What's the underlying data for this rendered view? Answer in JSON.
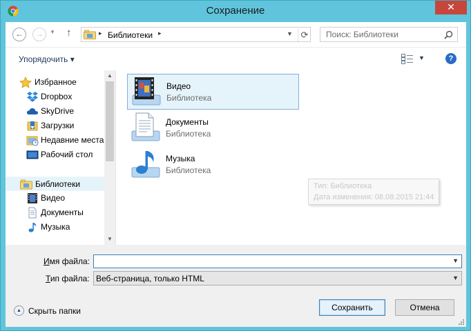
{
  "window": {
    "title": "Сохранение",
    "close_symbol": "✕",
    "app_icon": "chrome-icon"
  },
  "navigation": {
    "back_symbol": "←",
    "forward_symbol": "→",
    "recent_dropdown_symbol": "▼",
    "up_symbol": "↑",
    "address": {
      "location": "Библиотеки",
      "separator": "▸",
      "dropdown_symbol": "▼",
      "refresh_symbol": "⟳"
    },
    "search": {
      "placeholder": "Поиск: Библиотеки"
    }
  },
  "toolbar": {
    "organize_label": "Упорядочить ▾",
    "view_dropdown_symbol": "▼",
    "help_symbol": "?"
  },
  "nav_pane": {
    "favorites": {
      "label": "Избранное",
      "items": [
        {
          "label": "Dropbox",
          "icon": "dropbox-icon"
        },
        {
          "label": "SkyDrive",
          "icon": "cloud-icon"
        },
        {
          "label": "Загрузки",
          "icon": "downloads-folder-icon"
        },
        {
          "label": "Недавние места",
          "icon": "recent-places-icon"
        },
        {
          "label": "Рабочий стол",
          "icon": "desktop-icon"
        }
      ]
    },
    "libraries": {
      "label": "Библиотеки",
      "items": [
        {
          "label": "Видео",
          "icon": "video-library-icon"
        },
        {
          "label": "Документы",
          "icon": "documents-library-icon"
        },
        {
          "label": "Музыка",
          "icon": "music-library-icon"
        }
      ]
    },
    "scroll_up_symbol": "▲",
    "scroll_down_symbol": "▼"
  },
  "content": {
    "items": [
      {
        "name": "Видео",
        "type": "Библиотека",
        "icon": "video-library-icon",
        "selected": true
      },
      {
        "name": "Документы",
        "type": "Библиотека",
        "icon": "documents-library-icon",
        "selected": false
      },
      {
        "name": "Музыка",
        "type": "Библиотека",
        "icon": "music-library-icon",
        "selected": false
      }
    ],
    "tooltip": {
      "line1": "Тип: Библиотека",
      "line2": "Дата изменения: 08.08.2015 21:44"
    }
  },
  "form": {
    "filename_label_accel": "И",
    "filename_label_rest": "мя файла:",
    "filename_value": "",
    "filetype_label_accel": "Т",
    "filetype_label_rest": "ип файла:",
    "filetype_value": "Веб-страница, только HTML",
    "dropdown_symbol": "▼",
    "hide_folders_label": "Скрыть папки",
    "hide_folders_symbol": "▲",
    "save_label": "Сохранить",
    "cancel_label": "Отмена"
  },
  "colors": {
    "title_bar": "#60c5dc",
    "close_button": "#c7463c",
    "selection": "#e5f3fb",
    "selection_border": "#84acdd",
    "accent_blue": "#3c7fb1"
  }
}
